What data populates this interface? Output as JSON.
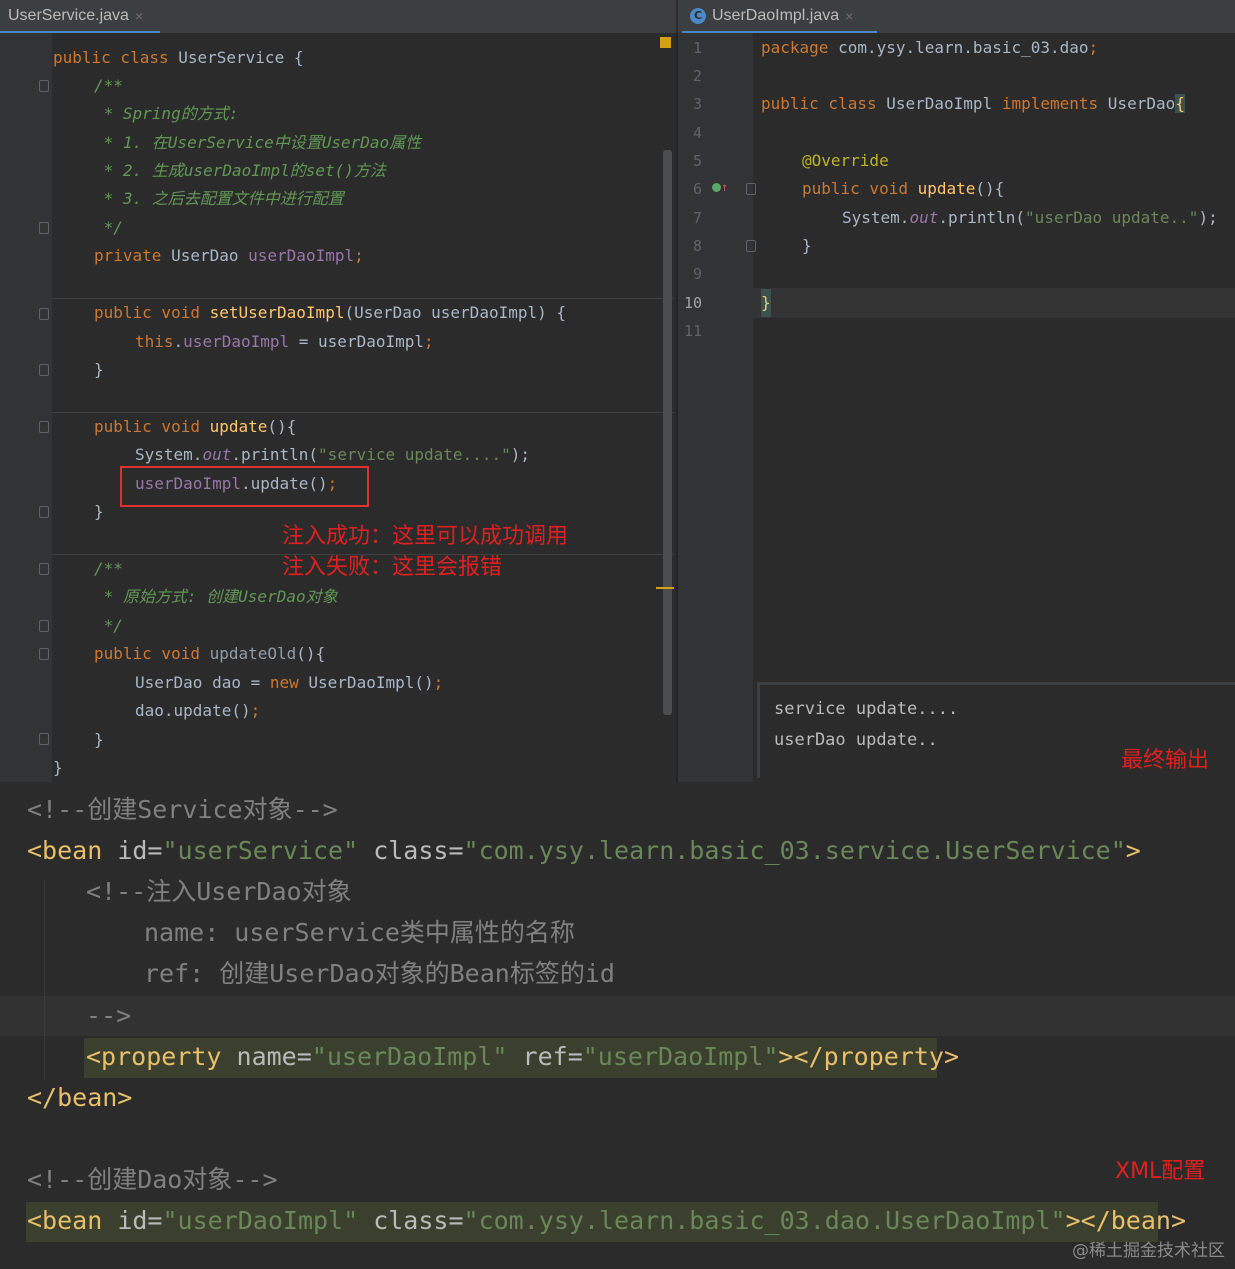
{
  "tabs": {
    "left": {
      "label": "UserService.java",
      "close": "×"
    },
    "right": {
      "label": "UserDaoImpl.java",
      "close": "×",
      "icon_letter": "C"
    }
  },
  "left_code": {
    "l1": {
      "a": "public",
      "b": " class ",
      "c": "UserService",
      "d": " {"
    },
    "l2": "/**",
    "l3": " * Spring的方式:",
    "l4": " * 1. 在UserService中设置UserDao属性",
    "l5": " * 2. 生成userDaoImpl的set()方法",
    "l6": " * 3. 之后去配置文件中进行配置",
    "l7": " */",
    "l8": {
      "a": "private",
      "b": " UserDao ",
      "c": "userDaoImpl",
      "d": ";"
    },
    "l9": {
      "a": "public void ",
      "b": "setUserDaoImpl",
      "c": "(UserDao userDaoImpl) {"
    },
    "l10": {
      "a": "this",
      "b": ".",
      "c": "userDaoImpl",
      "d": " = userDaoImpl",
      "e": ";"
    },
    "l11": "}",
    "l12": {
      "a": "public void ",
      "b": "update",
      "c": "(){"
    },
    "l13": {
      "a": "System.",
      "b": "out",
      "c": ".println(",
      "d": "\"service update....\"",
      "e": ");"
    },
    "l14": {
      "a": "userDaoImpl",
      "b": ".update()",
      "c": ";"
    },
    "l15": "}",
    "l16": "/**",
    "l17": " * 原始方式: 创建UserDao对象",
    "l18": " */",
    "l19": {
      "a": "public void ",
      "b": "updateOld",
      "c": "(){"
    },
    "l20": {
      "a": "UserDao dao = ",
      "b": "new",
      "c": " UserDaoImpl()",
      "d": ";"
    },
    "l21": {
      "a": "dao.update()",
      "b": ";"
    },
    "l22": "}",
    "l23": "}"
  },
  "annotations": {
    "success": "注入成功：这里可以成功调用",
    "failure": "注入失败：这里会报错",
    "final_output": "最终输出",
    "xml_config": "XML配置"
  },
  "right_code": {
    "line_numbers": [
      "1",
      "2",
      "3",
      "4",
      "5",
      "6",
      "7",
      "8",
      "9",
      "10",
      "11"
    ],
    "l1": {
      "a": "package",
      "b": " com.ysy.learn.basic_03.dao",
      "c": ";"
    },
    "l3": {
      "a": "public class ",
      "b": "UserDaoImpl ",
      "c": "implements ",
      "d": "UserDao",
      "e": "{"
    },
    "l5": "@Override",
    "l6": {
      "a": "public void ",
      "b": "update",
      "c": "(){"
    },
    "l7": {
      "a": "System.",
      "b": "out",
      "c": ".println(",
      "d": "\"userDao update..\"",
      "e": ");"
    },
    "l8": "}",
    "l10": "}"
  },
  "console": {
    "line1": "service update....",
    "line2": "userDao update.."
  },
  "xml": {
    "c1": "<!--创建Service对象-->",
    "bean1": {
      "open": "<bean ",
      "id_attr": "id",
      "eq": "=",
      "id_val": "\"userService\"",
      "class_attr": " class",
      "class_val": "\"com.ysy.learn.basic_03.service.UserService\"",
      "close": ">"
    },
    "c2": "<!--注入UserDao对象",
    "c3": "name: userService类中属性的名称",
    "c4": "ref: 创建UserDao对象的Bean标签的id",
    "c5": "-->",
    "prop": {
      "open": "<property ",
      "name_attr": "name",
      "name_val": "\"userDaoImpl\"",
      "ref_attr": " ref",
      "ref_val": "\"userDaoImpl\"",
      "close": "></property>"
    },
    "bean1_end": "</bean>",
    "c6": "<!--创建Dao对象-->",
    "bean2": {
      "open": "<bean ",
      "id_attr": "id",
      "id_val": "\"userDaoImpl\"",
      "class_attr": " class",
      "class_val": "\"com.ysy.learn.basic_03.dao.UserDaoImpl\"",
      "close": "></bean>"
    }
  },
  "watermark": "@稀土掘金技术社区"
}
